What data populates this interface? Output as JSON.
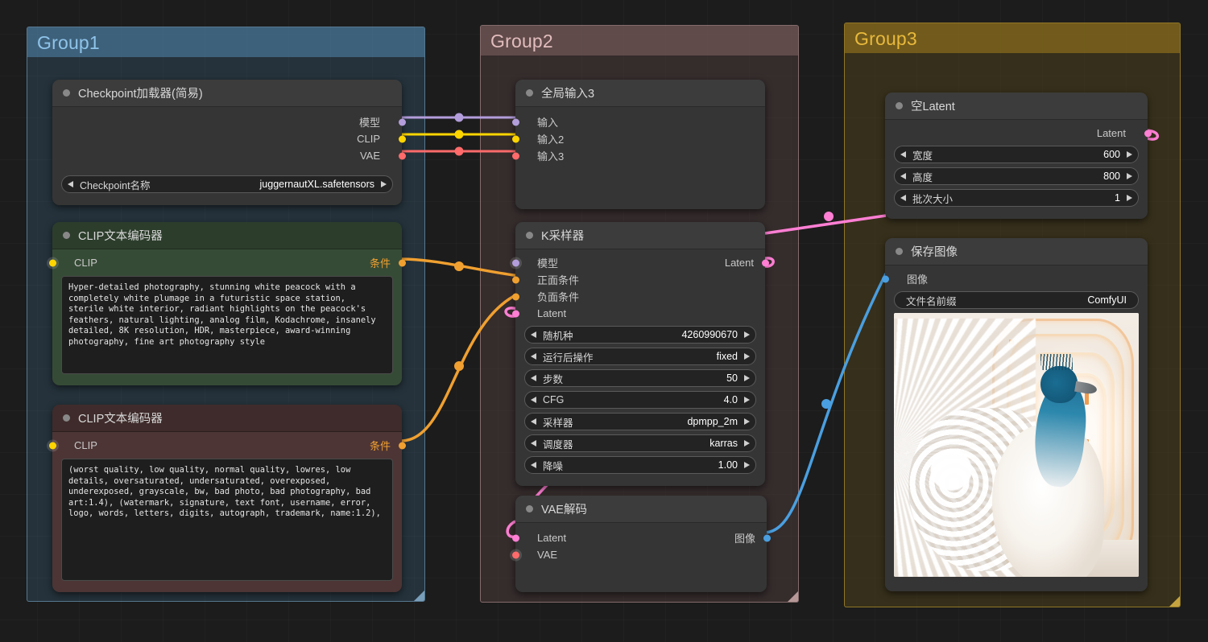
{
  "groups": [
    {
      "id": "group1",
      "title": "Group1",
      "color": "#5488b0"
    },
    {
      "id": "group2",
      "title": "Group2",
      "color": "#846464"
    },
    {
      "id": "group3",
      "title": "Group3",
      "color": "#96761c"
    }
  ],
  "nodes": {
    "checkpoint_loader": {
      "title": "Checkpoint加载器(简易)",
      "outputs": [
        {
          "label": "模型",
          "color": "#b39ddb"
        },
        {
          "label": "CLIP",
          "color": "#ffd500"
        },
        {
          "label": "VAE",
          "color": "#ff6b6b"
        }
      ],
      "widgets": [
        {
          "name": "Checkpoint名称",
          "value": "juggernautXL.safetensors"
        }
      ]
    },
    "clip_positive": {
      "title": "CLIP文本编码器",
      "input": {
        "label": "CLIP",
        "color": "#ffd500"
      },
      "output": {
        "label": "条件",
        "color": "#f0a030"
      },
      "text": "Hyper-detailed photography, stunning white peacock with a completely white plumage in a futuristic space station, sterile white interior, radiant highlights on the peacock's feathers, natural lighting, analog film, Kodachrome, insanely detailed, 8K resolution, HDR, masterpiece, award-winning photography, fine art photography style"
    },
    "clip_negative": {
      "title": "CLIP文本编码器",
      "input": {
        "label": "CLIP",
        "color": "#ffd500"
      },
      "output": {
        "label": "条件",
        "color": "#f0a030"
      },
      "text": "(worst quality, low quality, normal quality, lowres, low details, oversaturated, undersaturated, overexposed, underexposed, grayscale, bw, bad photo, bad photography, bad art:1.4), (watermark, signature, text font, username, error, logo, words, letters, digits, autograph, trademark, name:1.2),"
    },
    "global_input": {
      "title": "全局输入3",
      "inputs": [
        {
          "label": "输入",
          "color": "#b39ddb"
        },
        {
          "label": "输入2",
          "color": "#ffd500"
        },
        {
          "label": "输入3",
          "color": "#ff6b6b"
        }
      ]
    },
    "ksampler": {
      "title": "K采样器",
      "inputs": [
        {
          "label": "模型",
          "color": "#b39ddb"
        },
        {
          "label": "正面条件",
          "color": "#f0a030"
        },
        {
          "label": "负面条件",
          "color": "#f0a030"
        },
        {
          "label": "Latent",
          "color": "#ff7fd4"
        }
      ],
      "outputs": [
        {
          "label": "Latent",
          "color": "#ff7fd4"
        }
      ],
      "widgets": [
        {
          "name": "随机种",
          "value": "4260990670"
        },
        {
          "name": "运行后操作",
          "value": "fixed"
        },
        {
          "name": "步数",
          "value": "50"
        },
        {
          "name": "CFG",
          "value": "4.0"
        },
        {
          "name": "采样器",
          "value": "dpmpp_2m"
        },
        {
          "name": "调度器",
          "value": "karras"
        },
        {
          "name": "降噪",
          "value": "1.00"
        }
      ]
    },
    "vae_decode": {
      "title": "VAE解码",
      "inputs": [
        {
          "label": "Latent",
          "color": "#ff7fd4"
        },
        {
          "label": "VAE",
          "color": "#ff6b6b"
        }
      ],
      "outputs": [
        {
          "label": "图像",
          "color": "#4a9fe0"
        }
      ]
    },
    "empty_latent": {
      "title": "空Latent",
      "outputs": [
        {
          "label": "Latent",
          "color": "#ff7fd4"
        }
      ],
      "widgets": [
        {
          "name": "宽度",
          "value": "600"
        },
        {
          "name": "高度",
          "value": "800"
        },
        {
          "name": "批次大小",
          "value": "1"
        }
      ]
    },
    "save_image": {
      "title": "保存图像",
      "inputs": [
        {
          "label": "图像",
          "color": "#4a9fe0"
        }
      ],
      "widgets": [
        {
          "name": "文件名前缀",
          "value": "ComfyUI"
        }
      ],
      "preview_alt": "白孔雀在未来太空站走廊"
    }
  },
  "link_colors": {
    "model": "#b39ddb",
    "clip": "#ffd500",
    "vae": "#ff6b6b",
    "conditioning": "#f0a030",
    "latent": "#ff7fd4",
    "image": "#4a9fe0"
  }
}
